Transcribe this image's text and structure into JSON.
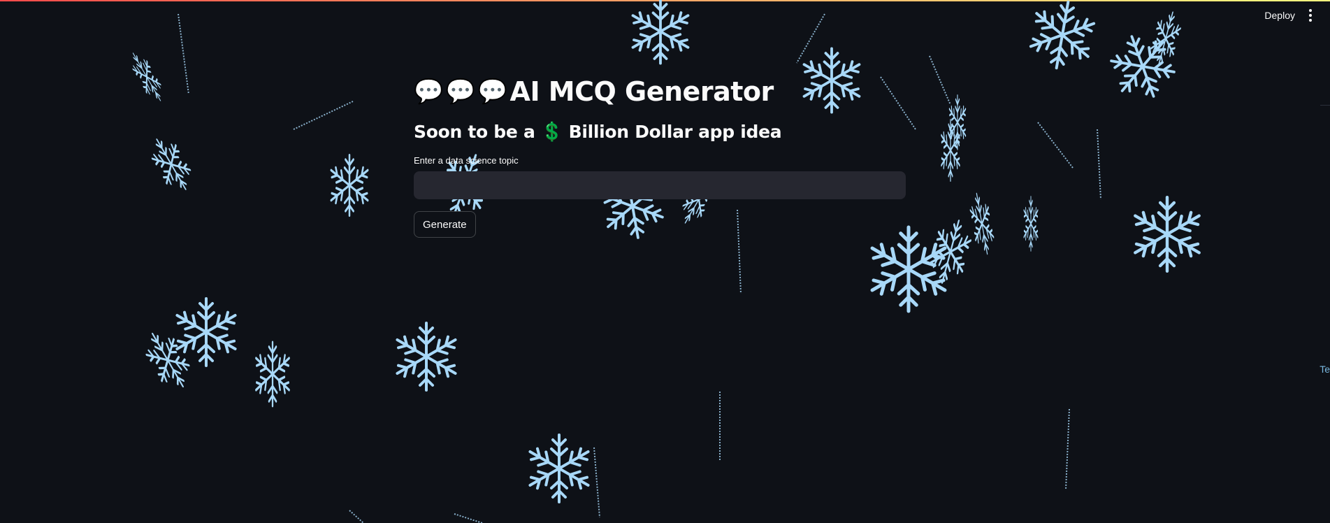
{
  "header": {
    "deploy_label": "Deploy",
    "menu_icon": "vertical-ellipsis-icon"
  },
  "title": {
    "emojis": [
      "💬",
      "💬",
      "💬"
    ],
    "text": "AI MCQ Generator"
  },
  "subheader": {
    "prefix": "Soon to be a",
    "icon": "💲",
    "suffix": "Billion Dollar app idea"
  },
  "topic_input": {
    "label": "Enter a data science topic",
    "value": "",
    "placeholder": ""
  },
  "generate_button": {
    "label": "Generate"
  },
  "edge_text": "Te",
  "colors": {
    "background": "#0e1117",
    "input_background": "#262730",
    "snowflake": "#a8d8f8",
    "dollar": "#2ecc71"
  }
}
